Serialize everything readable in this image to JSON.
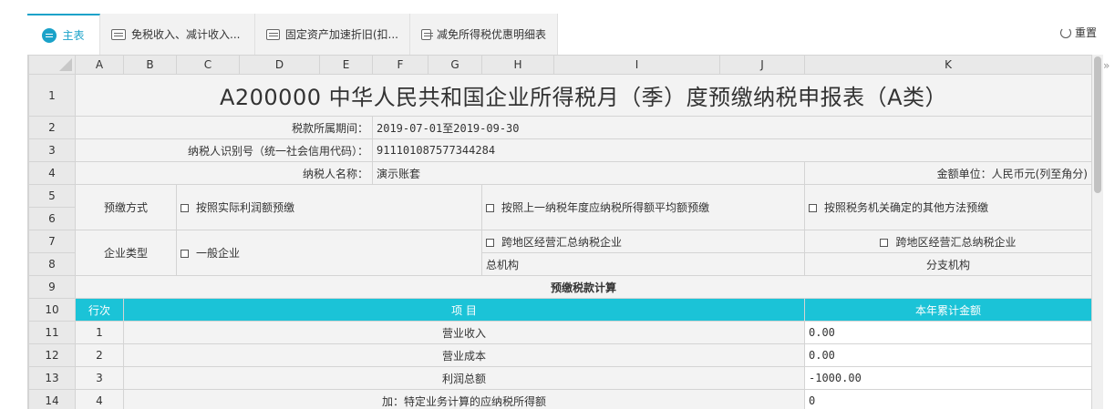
{
  "tabs": [
    {
      "label": "主表",
      "active": true
    },
    {
      "label": "免税收入、减计收入..."
    },
    {
      "label": "固定资产加速折旧(扣..."
    },
    {
      "label": "减免所得税优惠明细表"
    }
  ],
  "reset_label": "重置",
  "collapse_glyph": "»",
  "columns": [
    "A",
    "B",
    "C",
    "D",
    "E",
    "F",
    "G",
    "H",
    "I",
    "J",
    "K"
  ],
  "rows": [
    "1",
    "2",
    "3",
    "4",
    "5",
    "6",
    "7",
    "8",
    "9",
    "10",
    "11",
    "12",
    "13",
    "14"
  ],
  "form": {
    "title": "A200000 中华人民共和国企业所得税月（季）度预缴纳税申报表（A类）",
    "period_label": "税款所属期间：",
    "period_value": "2019-07-01至2019-09-30",
    "taxid_label": "纳税人识别号（统一社会信用代码）：",
    "taxid_value": "911101087577344284",
    "name_label": "纳税人名称：",
    "name_value": "演示账套",
    "unit_label": "金额单位：人民币元(列至角分)",
    "prepay_method_label": "预缴方式",
    "prepay_options": [
      "按照实际利润额预缴",
      "按照上一纳税年度应纳税所得额平均额预缴",
      "按照税务机关确定的其他方法预缴"
    ],
    "enterprise_type_label": "企业类型",
    "enterprise_options": [
      "一般企业",
      "跨地区经营汇总纳税企业",
      "跨地区经营汇总纳税企业"
    ],
    "hq_label": "总机构",
    "branch_label": "分支机构",
    "section_title": "预缴税款计算",
    "hdr_line": "行次",
    "hdr_item": "项 目",
    "hdr_amount": "本年累计金额",
    "lines": [
      {
        "no": "1",
        "item": "营业收入",
        "amount": "0.00"
      },
      {
        "no": "2",
        "item": "营业成本",
        "amount": "0.00"
      },
      {
        "no": "3",
        "item": "利润总额",
        "amount": "-1000.00"
      },
      {
        "no": "4",
        "item": "加：特定业务计算的应纳税所得额",
        "amount": "0"
      }
    ]
  }
}
